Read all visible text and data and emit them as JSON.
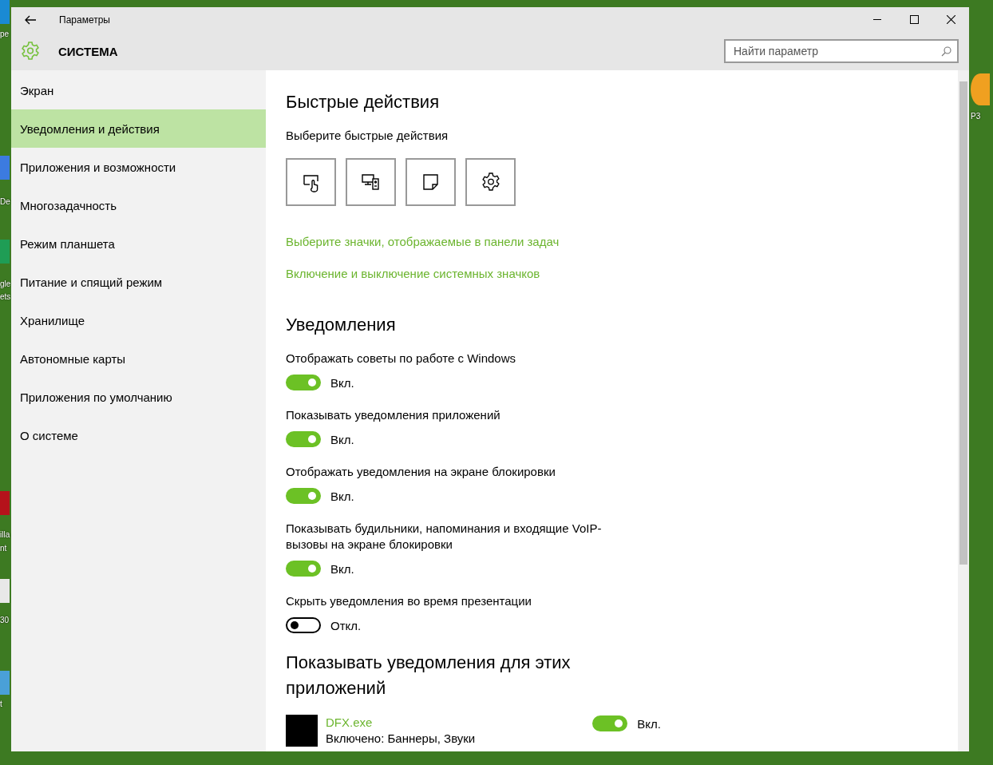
{
  "desktop": {
    "icon_labels": [
      "pe",
      "De",
      "gle",
      "ets",
      "illa",
      "nt",
      "30",
      "t",
      "P3"
    ]
  },
  "window": {
    "title": "Параметры",
    "section": "СИСТЕМА",
    "search": {
      "placeholder": "Найти параметр"
    }
  },
  "sidebar": {
    "items": [
      {
        "label": "Экран",
        "selected": false
      },
      {
        "label": "Уведомления и действия",
        "selected": true
      },
      {
        "label": "Приложения и возможности",
        "selected": false
      },
      {
        "label": "Многозадачность",
        "selected": false
      },
      {
        "label": "Режим планшета",
        "selected": false
      },
      {
        "label": "Питание и спящий режим",
        "selected": false
      },
      {
        "label": "Хранилище",
        "selected": false
      },
      {
        "label": "Автономные карты",
        "selected": false
      },
      {
        "label": "Приложения по умолчанию",
        "selected": false
      },
      {
        "label": "О системе",
        "selected": false
      }
    ]
  },
  "quick_actions": {
    "heading": "Быстрые действия",
    "subheading": "Выберите быстрые действия",
    "tiles": [
      {
        "kind": "tablet"
      },
      {
        "kind": "project"
      },
      {
        "kind": "note"
      },
      {
        "kind": "settings"
      }
    ],
    "links": [
      "Выберите значки, отображаемые в панели задач",
      "Включение и выключение системных значков"
    ]
  },
  "notifications": {
    "heading": "Уведомления",
    "settings": [
      {
        "label": "Отображать советы по работе с Windows",
        "on": true,
        "state_text": "Вкл."
      },
      {
        "label": "Показывать уведомления приложений",
        "on": true,
        "state_text": "Вкл."
      },
      {
        "label": "Отображать уведомления на экране блокировки",
        "on": true,
        "state_text": "Вкл."
      },
      {
        "label": "Показывать будильники, напоминания и входящие VoIP-вызовы на экране блокировки",
        "on": true,
        "state_text": "Вкл."
      },
      {
        "label": "Скрыть уведомления во время презентации",
        "on": false,
        "state_text": "Откл."
      }
    ]
  },
  "apps": {
    "heading": "Показывать уведомления для этих приложений",
    "items": [
      {
        "name": "DFX.exe",
        "detail": "Включено: Баннеры, Звуки",
        "on": true,
        "state_text": "Вкл."
      }
    ]
  }
}
